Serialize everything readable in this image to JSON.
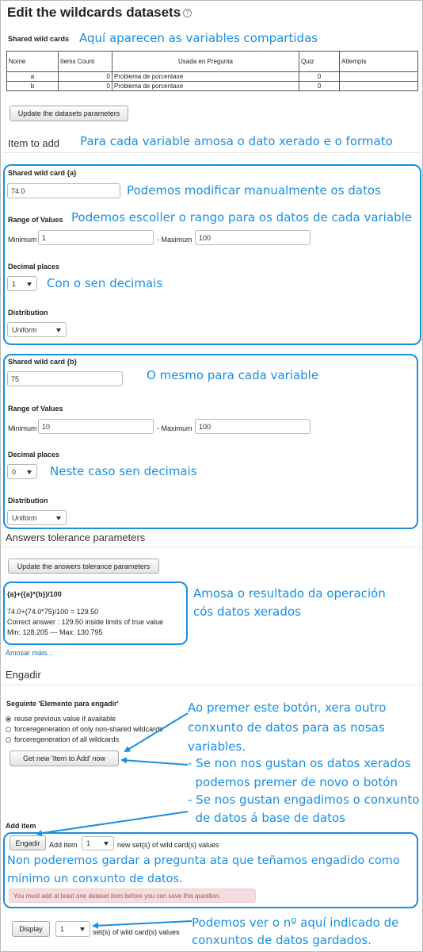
{
  "page": {
    "title": "Edit the wildcards datasets",
    "help_icon_glyph": "?"
  },
  "shared": {
    "label": "Shared wild cards",
    "note": "Aquí aparecen as variables compartidas",
    "columns": [
      "Nome",
      "Items Count",
      "Usada en Pregunta",
      "Quiz",
      "Attempts"
    ],
    "rows": [
      {
        "name": "a",
        "count": "0",
        "used_in": "Problema de porcentaxe",
        "quiz": "0",
        "attempts": ""
      },
      {
        "name": "b",
        "count": "0",
        "used_in": "Problema de porcentaxe",
        "quiz": "0",
        "attempts": ""
      }
    ],
    "update_button": "Update the datasets parameters"
  },
  "item_to_add": {
    "heading": "Item to add",
    "note": "Para cada variable amosa o dato xerado e o formato"
  },
  "wildcard_a": {
    "label": "Shared wild card {a}",
    "value": "74.0",
    "value_note": "Podemos modificar manualmente os datos",
    "range_label": "Range of Values",
    "range_note": "Podemos escoller o rango para os datos de cada variable",
    "min_label": "Minimum",
    "min_value": "1",
    "max_label": "- Maximum",
    "max_value": "100",
    "decimal_label": "Decimal places",
    "decimal_value": "1",
    "decimal_note": "Con o sen decimais",
    "distribution_label": "Distribution",
    "distribution_value": "Uniform"
  },
  "wildcard_b": {
    "label": "Shared wild card {b}",
    "value": "75",
    "value_note": "O mesmo para cada variable",
    "range_label": "Range of Values",
    "min_label": "Minimum",
    "min_value": "10",
    "max_label": "- Maximum",
    "max_value": "100",
    "decimal_label": "Decimal places",
    "decimal_value": "0",
    "decimal_note": "Neste caso sen decimais",
    "distribution_label": "Distribution",
    "distribution_value": "Uniform"
  },
  "tolerance": {
    "heading": "Answers tolerance parameters",
    "update_button": "Update the answers tolerance parameters",
    "formula": "{a}+({a}*{b})/100",
    "line1": "74.0+(74.0*75)/100 = 129.50",
    "line2": "Correct answer : 129.50 inside limits of true value",
    "line3": "Min: 128.205 --- Max: 130.795",
    "note_line1": "Amosa o resultado da operación",
    "note_line2": "cós datos xerados",
    "more_link": "Amosar máis..."
  },
  "engadir": {
    "heading": "Engadir",
    "next_label": "Seguinte 'Elemento para engadir'",
    "radio_options": [
      {
        "label": "reuse previous value if available",
        "checked": true
      },
      {
        "label": "forceregeneration of only non-shared wildcards",
        "checked": false
      },
      {
        "label": "forceregeneration of all wildcards",
        "checked": false
      }
    ],
    "get_new_button": "Get new 'Item to Add' now",
    "note_lines": [
      "Ao premer este botón, xera outro",
      "conxunto de datos para as nosas",
      "variables.",
      "- Se non nos gustan os datos xerados",
      "  podemos premer de novo o botón",
      "- Se nos gustan engadimos o conxunto",
      "  de datos á base de datos"
    ]
  },
  "add_item": {
    "label": "Add item",
    "engadir_button": "Engadir",
    "add_item_text": "Add item",
    "count_value": "1",
    "suffix": "new set(s) of wild card(s) values",
    "note_line1": "Non poderemos gardar a pregunta ata que teñamos engadido como",
    "note_line2": "mínimo un conxunto de datos.",
    "alert": "You must add at least one dataset item before you can save this question."
  },
  "display": {
    "button": "Display",
    "count_value": "1",
    "suffix": "set(s) of wild card(s) values",
    "note_line1": "Podemos ver o nº aquí indicado de",
    "note_line2": "conxuntos de datos gardados."
  },
  "colors": {
    "annotation_blue": "#1a8fe0",
    "alert_bg": "#f2dede",
    "alert_text": "#b94a48"
  }
}
